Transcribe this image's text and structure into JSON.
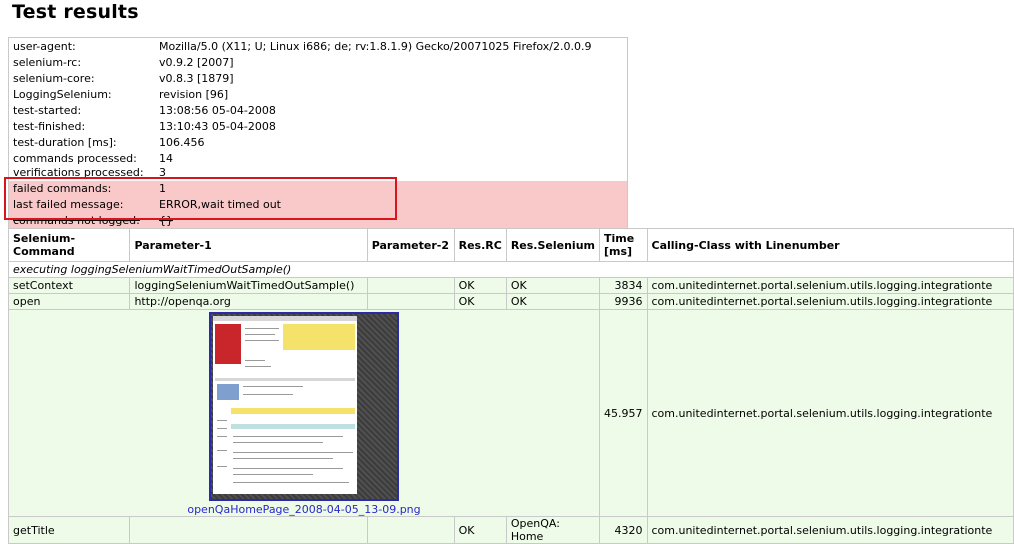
{
  "page_title": "Test results",
  "info": [
    {
      "key": "user-agent:",
      "value": "Mozilla/5.0 (X11; U; Linux i686; de; rv:1.8.1.9) Gecko/20071025 Firefox/2.0.0.9"
    },
    {
      "key": "selenium-rc:",
      "value": "v0.9.2 [2007]"
    },
    {
      "key": "selenium-core:",
      "value": "v0.8.3 [1879]"
    },
    {
      "key": "LoggingSelenium:",
      "value": "revision [96]"
    },
    {
      "key": "test-started:",
      "value": "13:08:56 05-04-2008"
    },
    {
      "key": "test-finished:",
      "value": "13:10:43 05-04-2008"
    },
    {
      "key": "test-duration [ms]:",
      "value": "106.456"
    },
    {
      "key": "commands processed:",
      "value": "14"
    },
    {
      "key": "verifications processed:",
      "value": "3"
    },
    {
      "key": "failed commands:",
      "value": "1"
    },
    {
      "key": "last failed message:",
      "value": "ERROR,wait timed out"
    },
    {
      "key": "commands not logged:",
      "value": "{}"
    }
  ],
  "table": {
    "headers": [
      "Selenium-Command",
      "Parameter-1",
      "Parameter-2",
      "Res.RC",
      "Res.Selenium",
      "Time [ms]",
      "Calling-Class with Linenumber"
    ],
    "group_label": "executing loggingSeleniumWaitTimedOutSample()",
    "rows": [
      {
        "command": "setContext",
        "param1": "loggingSeleniumWaitTimedOutSample()",
        "param2": "",
        "res_rc": "OK",
        "res_selenium": "OK",
        "time": "3834",
        "calling_class": "com.unitedinternet.portal.selenium.utils.logging.integrationte"
      },
      {
        "command": "open",
        "param1": "http://openqa.org",
        "param2": "",
        "res_rc": "OK",
        "res_selenium": "OK",
        "time": "9936",
        "calling_class": "com.unitedinternet.portal.selenium.utils.logging.integrationte"
      },
      {
        "command": "",
        "param1": "",
        "param2": "",
        "res_rc": "",
        "res_selenium": "",
        "time": "45.957",
        "calling_class": "com.unitedinternet.portal.selenium.utils.logging.integrationte",
        "screenshot_link": "openQaHomePage_2008-04-05_13-09.png"
      },
      {
        "command": "getTitle",
        "param1": "",
        "param2": "",
        "res_rc": "OK",
        "res_selenium": "OpenQA: Home",
        "time": "4320",
        "calling_class": "com.unitedinternet.portal.selenium.utils.logging.integrationte"
      }
    ]
  },
  "colors": {
    "failed_highlight": "#f9c8c8",
    "ok_row": "#eefbe8",
    "red_box": "#d9141c",
    "link": "#2828c8"
  }
}
